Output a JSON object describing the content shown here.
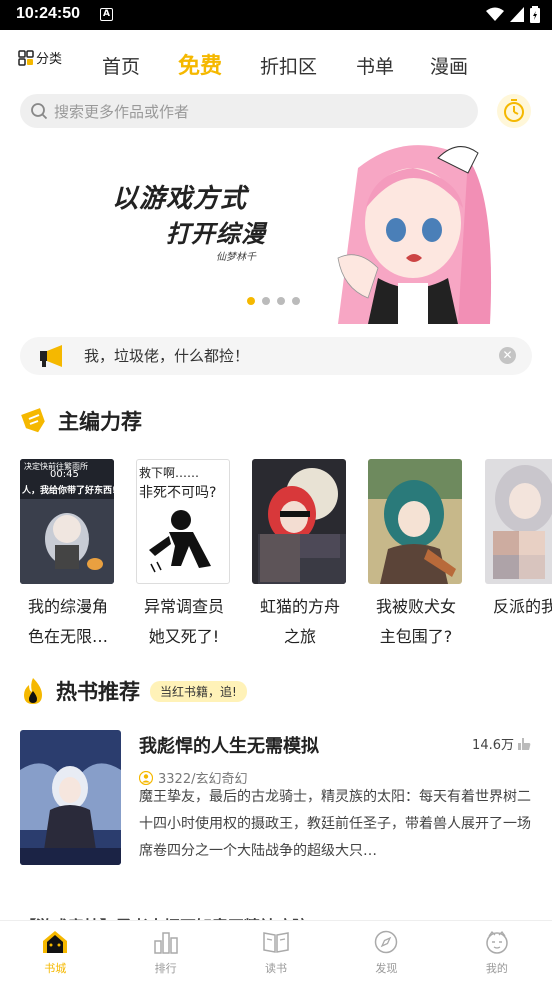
{
  "status_bar": {
    "time": "10:24:50",
    "notification_icon": "A"
  },
  "top_nav": {
    "category_label": "分类",
    "tabs": [
      {
        "label": "首页",
        "active": false
      },
      {
        "label": "免费",
        "active": true
      },
      {
        "label": "折扣区",
        "active": false
      },
      {
        "label": "书单",
        "active": false
      },
      {
        "label": "漫画",
        "active": false
      }
    ]
  },
  "search": {
    "placeholder": "搜索更多作品或作者"
  },
  "banner": {
    "slogan_line1": "以游戏方式",
    "slogan_line2": "打开综漫",
    "brand": "仙梦林千",
    "total_slides": 4,
    "active_slide": 1
  },
  "notice": {
    "text": "我，垃圾佬，什么都捡！"
  },
  "editor_picks": {
    "title": "主编力荐",
    "books": [
      {
        "title_line1": "我的综漫角",
        "title_line2": "色在无限…",
        "cover_text_top": "决定快前往繁雨所",
        "cover_text_mid": "00:45",
        "cover_text_bottom": "人，我给你带了好东西!"
      },
      {
        "title_line1": "异常调查员",
        "title_line2": "她又死了!",
        "cover_text_top": "救下啊……",
        "cover_text_mid": "非死不可吗?"
      },
      {
        "title_line1": "虹猫的方舟",
        "title_line2": "之旅"
      },
      {
        "title_line1": "我被败犬女",
        "title_line2": "主包围了?"
      },
      {
        "title_line1": "",
        "title_line2": "反派的我"
      }
    ]
  },
  "hot_books": {
    "title": "热书推荐",
    "tag": "当红书籍，追!",
    "items": [
      {
        "title": "我彪悍的人生无需模拟",
        "heat": "14.6万",
        "meta": "3322/玄幻奇幻",
        "description": "魔王挚友，最后的古龙骑士，精灵族的太阳：每天有着世界树二十四小时使用权的摄政王，教廷前任圣子，带着兽人展开了一场席卷四分之一个大陆战争的超级大只…"
      }
    ]
  },
  "next_item_partial": "【游戏竞技】勇者大招不知意开精神病院",
  "tab_bar": {
    "tabs": [
      {
        "label": "书城",
        "active": true
      },
      {
        "label": "排行",
        "active": false
      },
      {
        "label": "读书",
        "active": false
      },
      {
        "label": "发现",
        "active": false
      },
      {
        "label": "我的",
        "active": false
      }
    ]
  },
  "colors": {
    "accent": "#f5b800",
    "tag_bg": "#fff2b8"
  }
}
